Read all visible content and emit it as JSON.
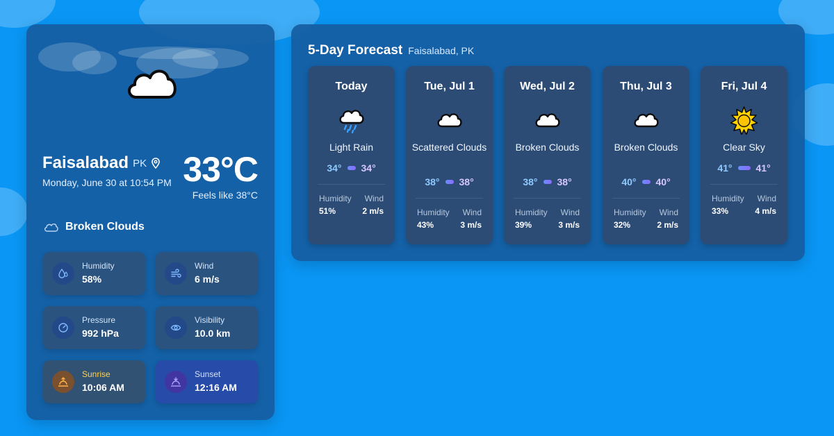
{
  "current": {
    "city": "Faisalabad",
    "country": "PK",
    "datetime": "Monday, June 30 at 10:54 PM",
    "temperature": "33°C",
    "feels_like": "Feels like 38°C",
    "condition": "Broken Clouds",
    "icon": "cloud-icon",
    "stats": {
      "humidity": {
        "label": "Humidity",
        "value": "58%",
        "icon": "humidity-icon"
      },
      "wind": {
        "label": "Wind",
        "value": "6 m/s",
        "icon": "wind-icon"
      },
      "pressure": {
        "label": "Pressure",
        "value": "992 hPa",
        "icon": "gauge-icon"
      },
      "visibility": {
        "label": "Visibility",
        "value": "10.0 km",
        "icon": "eye-icon"
      },
      "sunrise": {
        "label": "Sunrise",
        "value": "10:06 AM",
        "icon": "sunrise-icon"
      },
      "sunset": {
        "label": "Sunset",
        "value": "12:16 AM",
        "icon": "sunset-icon"
      }
    }
  },
  "forecast": {
    "title": "5-Day Forecast",
    "location": "Faisalabad, PK",
    "days": [
      {
        "name": "Today",
        "desc": "Light Rain",
        "min": "34°",
        "max": "34°",
        "humidity_label": "Humidity",
        "humidity": "51%",
        "wind_label": "Wind",
        "wind": "2 m/s",
        "icon": "rain-cloud-icon"
      },
      {
        "name": "Tue, Jul 1",
        "desc": "Scattered Clouds",
        "min": "38°",
        "max": "38°",
        "humidity_label": "Humidity",
        "humidity": "43%",
        "wind_label": "Wind",
        "wind": "3 m/s",
        "icon": "cloud-icon"
      },
      {
        "name": "Wed, Jul 2",
        "desc": "Broken Clouds",
        "min": "38°",
        "max": "38°",
        "humidity_label": "Humidity",
        "humidity": "39%",
        "wind_label": "Wind",
        "wind": "3 m/s",
        "icon": "cloud-icon"
      },
      {
        "name": "Thu, Jul 3",
        "desc": "Broken Clouds",
        "min": "40°",
        "max": "40°",
        "humidity_label": "Humidity",
        "humidity": "32%",
        "wind_label": "Wind",
        "wind": "2 m/s",
        "icon": "cloud-icon"
      },
      {
        "name": "Fri, Jul 4",
        "desc": "Clear Sky",
        "min": "41°",
        "max": "41°",
        "humidity_label": "Humidity",
        "humidity": "33%",
        "wind_label": "Wind",
        "wind": "4 m/s",
        "icon": "sun-icon"
      }
    ]
  },
  "colors": {
    "background": "#0a96f5",
    "card": "#165ca0",
    "temp_min": "#8ec9ff",
    "temp_max": "#d6c8ff",
    "sunrise_label": "#ffd34d"
  }
}
